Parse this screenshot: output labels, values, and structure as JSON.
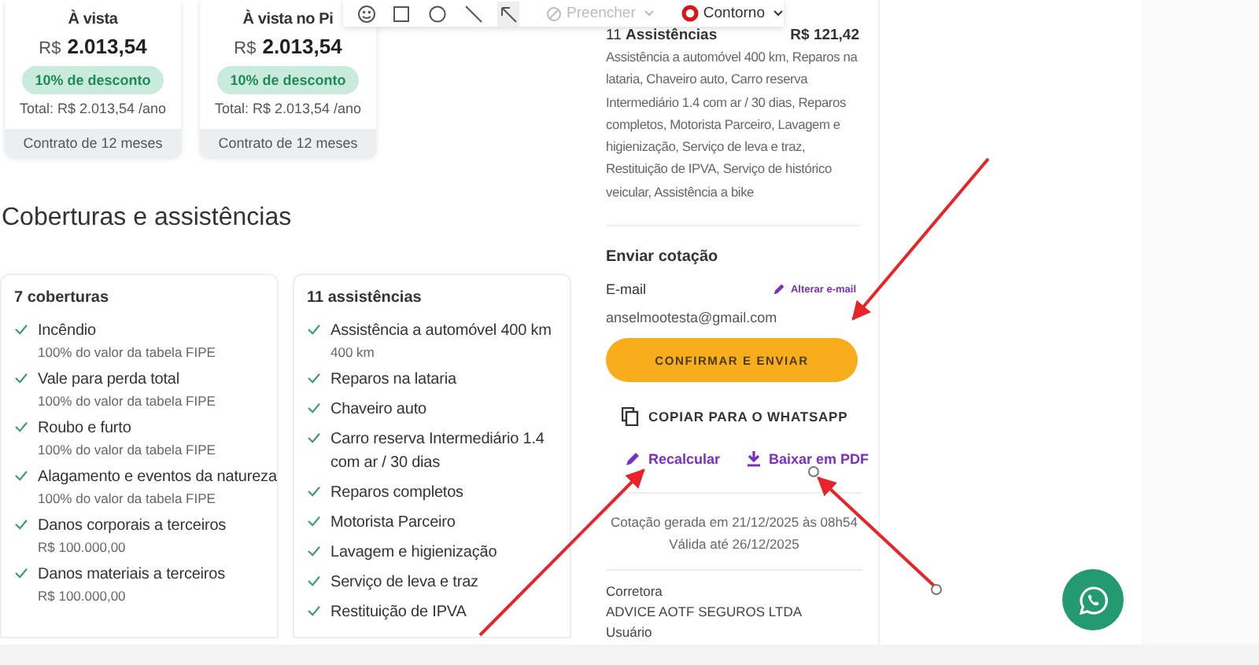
{
  "price_cards": [
    {
      "title": "À vista",
      "currency": "R$",
      "amount": "2.013,54",
      "discount": "10% de desconto",
      "total": "Total: R$ 2.013,54 /ano",
      "contract": "Contrato de 12 meses"
    },
    {
      "title": "À vista no Pi",
      "currency": "R$",
      "amount": "2.013,54",
      "discount": "10% de desconto",
      "total": "Total: R$ 2.013,54 /ano",
      "contract": "Contrato de 12 meses"
    }
  ],
  "toolbar": {
    "tools": [
      {
        "kind": "emoji",
        "selected": false
      },
      {
        "kind": "square",
        "selected": false
      },
      {
        "kind": "circle",
        "selected": false
      },
      {
        "kind": "line",
        "selected": false
      },
      {
        "kind": "arrow",
        "selected": true
      }
    ],
    "fill": {
      "label": "Preencher",
      "disabled": true
    },
    "outline": {
      "label": "Contorno",
      "disabled": false
    }
  },
  "section_title": "Coberturas e assistências",
  "coverages": {
    "title": "7 coberturas",
    "items": [
      {
        "name": "Incêndio",
        "detail": "100% do valor da tabela FIPE"
      },
      {
        "name": "Vale para perda total",
        "detail": "100% do valor da tabela FIPE"
      },
      {
        "name": "Roubo e furto",
        "detail": "100% do valor da tabela FIPE"
      },
      {
        "name": "Alagamento e eventos da natureza",
        "detail": "100% do valor da tabela FIPE"
      },
      {
        "name": "Danos corporais a terceiros",
        "detail": "R$ 100.000,00"
      },
      {
        "name": "Danos materiais a terceiros",
        "detail": "R$ 100.000,00"
      }
    ]
  },
  "assistances": {
    "title": "11 assistências",
    "items": [
      {
        "name": "Assistência a automóvel 400 km",
        "detail": "400 km"
      },
      {
        "name": "Reparos na lataria"
      },
      {
        "name": "Chaveiro auto"
      },
      {
        "name": "Carro reserva Intermediário 1.4 com ar / 30 dias"
      },
      {
        "name": "Reparos completos"
      },
      {
        "name": "Motorista Parceiro"
      },
      {
        "name": "Lavagem e higienização"
      },
      {
        "name": "Serviço de leva e traz"
      },
      {
        "name": "Restituição de IPVA"
      }
    ]
  },
  "summary": {
    "heading": "11 **Assistências**",
    "price": "R$ 121,42",
    "description": "Assistência a automóvel 400 km, Reparos na lataria, Chaveiro auto, Carro reserva Intermediário 1.4 com ar / 30 dias, Reparos completos, Motorista Parceiro, Lavagem e higienização, Serviço de leva e traz, Restituição de IPVA, Serviço de histórico veicular, Assistência a bike"
  },
  "send": {
    "title": "Enviar cotação",
    "email_label": "E-mail",
    "change_email": "Alterar e-mail",
    "email": "anselmootesta@gmail.com",
    "confirm": "CONFIRMAR E ENVIAR",
    "copy": "COPIAR PARA O WHATSAPP",
    "recalc": "Recalcular",
    "pdf": "Baixar em PDF"
  },
  "generated": "Cotação gerada em 21/12/2025 às 08h54",
  "valid": "Válida até 26/12/2025",
  "broker": {
    "label": "Corretora",
    "name": "ADVICE AOTF SEGUROS LTDA",
    "user_label": "Usuário"
  }
}
